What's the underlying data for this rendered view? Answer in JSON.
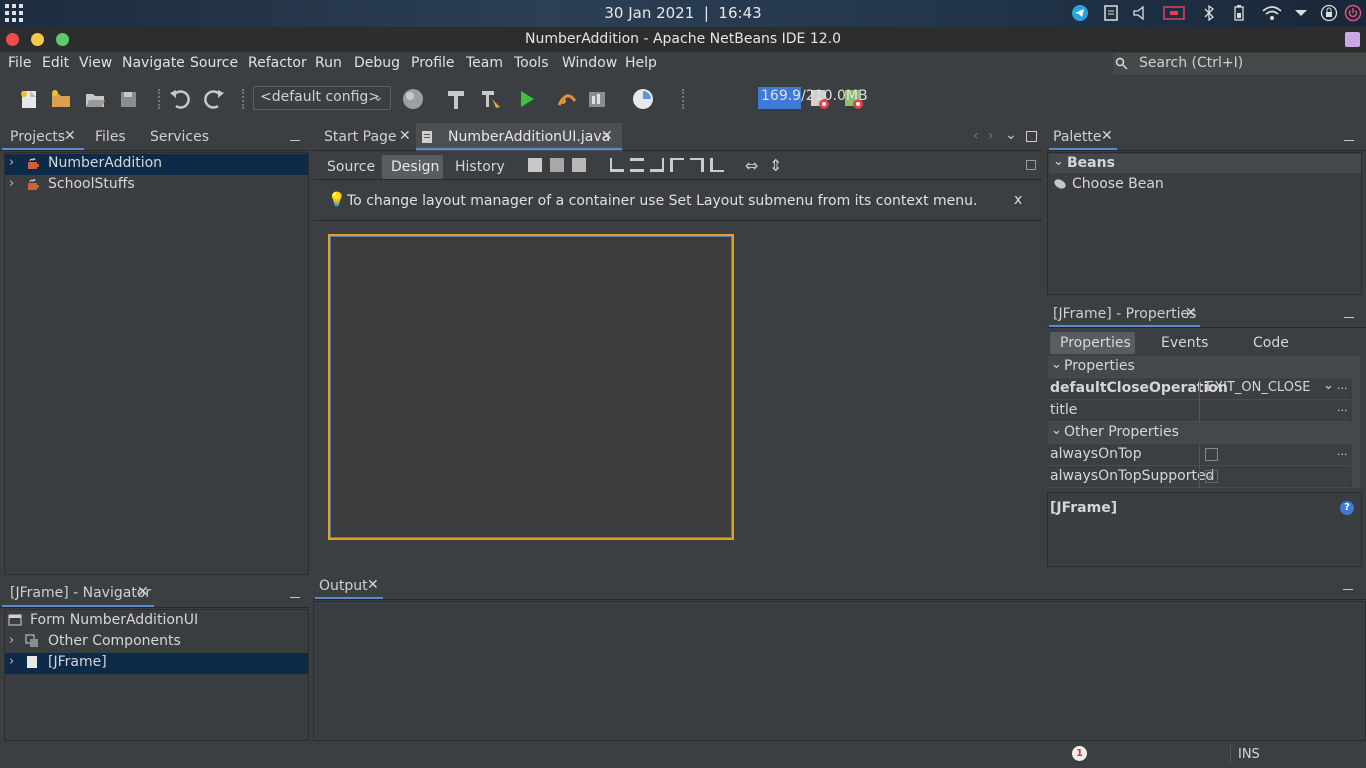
{
  "system_bar": {
    "date": "30 Jan 2021",
    "time": "16:43",
    "separator": "|"
  },
  "window": {
    "title": "NumberAddition - Apache NetBeans IDE 12.0"
  },
  "menu": [
    "File",
    "Edit",
    "View",
    "Navigate",
    "Source",
    "Refactor",
    "Run",
    "Debug",
    "Profile",
    "Team",
    "Tools",
    "Window",
    "Help"
  ],
  "search": {
    "placeholder": "Search (Ctrl+I)"
  },
  "toolbar": {
    "config": "<default config>",
    "memory": "169.9/210.0MB"
  },
  "projects_panel": {
    "tabs": [
      "Projects",
      "Files",
      "Services"
    ],
    "items": [
      "NumberAddition",
      "SchoolStuffs"
    ]
  },
  "navigator_panel": {
    "title": "[JFrame] - Navigator",
    "items": [
      "Form NumberAdditionUI",
      "Other Components",
      "[JFrame]"
    ]
  },
  "editor": {
    "tabs": [
      "Start Page",
      "NumberAdditionUI.java"
    ],
    "views": [
      "Source",
      "Design",
      "History"
    ],
    "hint": "To change layout manager of a container use Set Layout submenu from its context menu.",
    "hint_close": "x"
  },
  "palette": {
    "title": "Palette",
    "group": "Beans",
    "item": "Choose Bean"
  },
  "properties": {
    "title": "[JFrame] - Properties",
    "tabs": [
      "Properties",
      "Events",
      "Code"
    ],
    "group1": "Properties",
    "rows1": [
      {
        "name": "defaultCloseOperation",
        "value": "EXIT_ON_CLOSE"
      },
      {
        "name": "title",
        "value": ""
      }
    ],
    "group2": "Other Properties",
    "rows2": [
      {
        "name": "alwaysOnTop",
        "checked": false
      },
      {
        "name": "alwaysOnTopSupported",
        "checked": true
      }
    ],
    "description_title": "[JFrame]",
    "ellipsis": "..."
  },
  "output": {
    "title": "Output"
  },
  "status": {
    "mode": "INS",
    "notifications": "1"
  }
}
